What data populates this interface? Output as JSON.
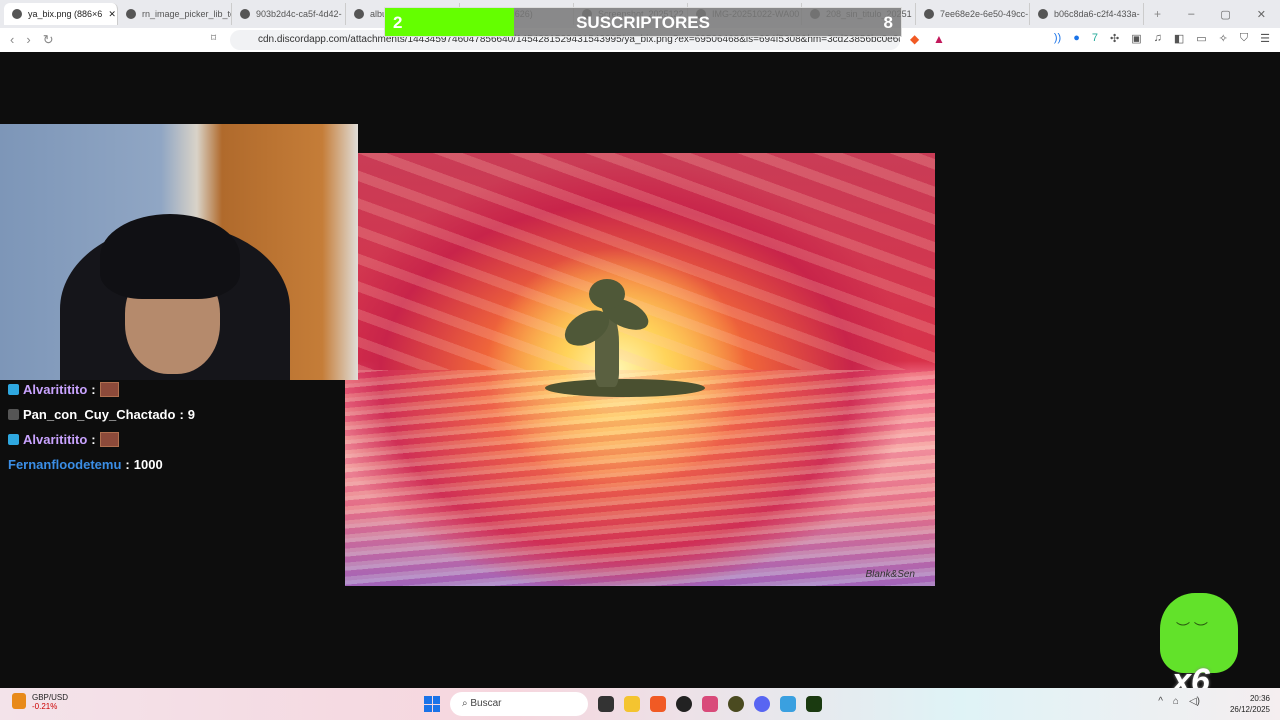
{
  "browser": {
    "tabs": [
      {
        "label": "ya_bix.png (886×6",
        "active": true
      },
      {
        "label": "rn_image_picker_lib_te"
      },
      {
        "label": "903b2d4c-ca5f-4d42-"
      },
      {
        "label": "albu"
      },
      {
        "label": "g (695×626)"
      },
      {
        "label": "Screenshot_2025122"
      },
      {
        "label": "IMG-20251022-WA00"
      },
      {
        "label": "208_sin_titulo_20251"
      },
      {
        "label": "7ee68e2e-6e50-49cc-"
      },
      {
        "label": "b06c8da6-c2f4-433a-"
      }
    ],
    "new_tab": "+",
    "minimize": "–",
    "maximize": "▢",
    "close": "✕",
    "url": "cdn.discordapp.com/attachments/1443459746047856640/1454281529431543995/ya_bix.png?ex=69506468&is=694f5308&hm=3cd23856bc0e6d230..."
  },
  "overlay": {
    "sub_goal": {
      "current": "2",
      "label": "SUSCRIPTORES",
      "target": "8",
      "progress": 0.25,
      "color": "#64ff00"
    },
    "painting_signature": "Blank&Sen",
    "mascot_multiplier": "x6"
  },
  "chat": [
    {
      "user": "Alvarititito",
      "sep": " :",
      "message": "",
      "emote": true,
      "color": "#c9a3ff",
      "badge": "#2fa8e0"
    },
    {
      "user": "Pan_con_Cuy_Chactado",
      "sep": " :",
      "message": " 9",
      "emote": false,
      "color": "#ffffff",
      "badge": "#555"
    },
    {
      "user": "Alvarititito",
      "sep": " :",
      "message": "",
      "emote": true,
      "color": "#c9a3ff",
      "badge": "#2fa8e0"
    },
    {
      "user": "Fernanfloodetemu",
      "sep": " :",
      "message": " 1000",
      "emote": false,
      "color": "#3b8ee6",
      "badge": null
    }
  ],
  "taskbar": {
    "widget_title": "GBP/USD",
    "widget_value": "-0.21%",
    "search_placeholder": "Buscar",
    "time": "20:36",
    "date": "26/12/2025"
  }
}
